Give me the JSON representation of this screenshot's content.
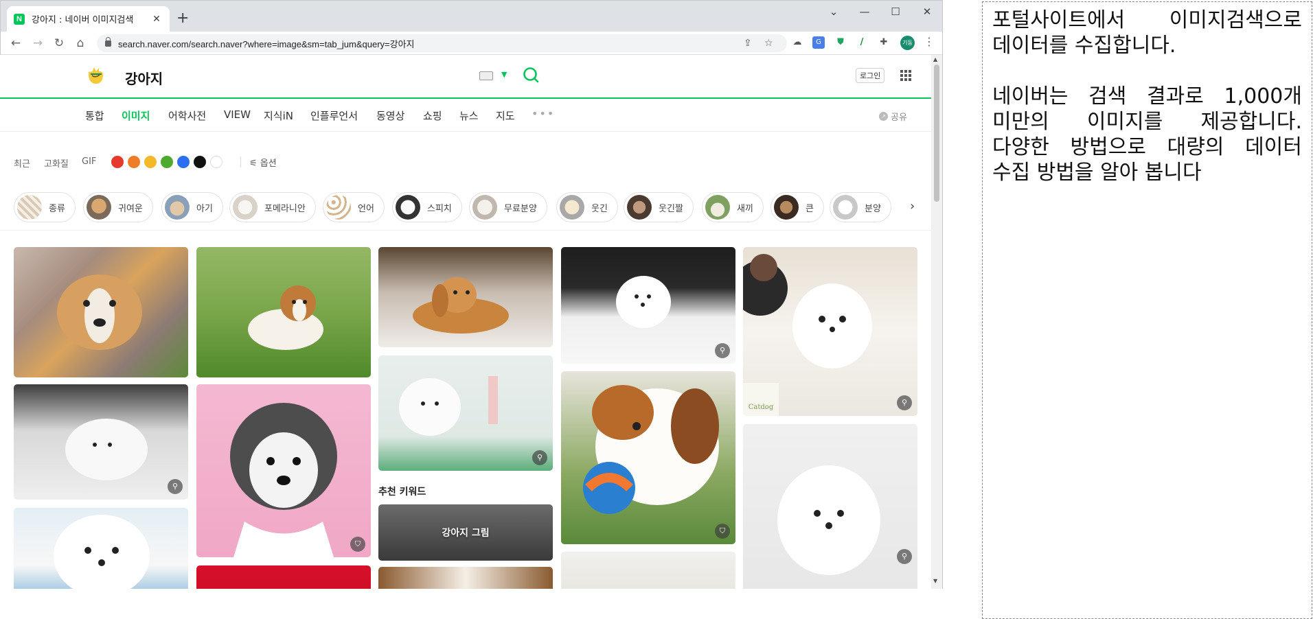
{
  "browser": {
    "tab_title": "강아지 : 네이버 이미지검색",
    "tab_favicon": "N",
    "tab_close_icon": "✕",
    "new_tab_icon": "+",
    "window_controls": {
      "dropdown": "⌄",
      "minimize": "—",
      "maximize": "☐",
      "close": "✕"
    },
    "url": "search.naver.com/search.naver?where=image&sm=tab_jum&query=강아지",
    "profile_label": "기동"
  },
  "naver": {
    "query": "강아지",
    "login_label": "로그인",
    "accent_color": "#03c75a",
    "tabs": [
      {
        "label": "통합",
        "active": false
      },
      {
        "label": "이미지",
        "active": true
      },
      {
        "label": "어학사전",
        "active": false
      },
      {
        "label": "VIEW",
        "active": false
      },
      {
        "label": "지식iN",
        "active": false
      },
      {
        "label": "인플루언서",
        "active": false
      },
      {
        "label": "동영상",
        "active": false
      },
      {
        "label": "쇼핑",
        "active": false
      },
      {
        "label": "뉴스",
        "active": false
      },
      {
        "label": "지도",
        "active": false
      }
    ],
    "more_label": "•••",
    "share_label": "공유",
    "filters": {
      "recent": "최근",
      "hd": "고화질",
      "gif": "GIF",
      "option": "옵션"
    },
    "filter_colors": [
      "#e8372c",
      "#f07c28",
      "#f5b829",
      "#4eaa2f",
      "#2b6ff0",
      "#111111",
      "#ffffff"
    ],
    "chips": [
      {
        "label": "종류"
      },
      {
        "label": "귀여운"
      },
      {
        "label": "아기"
      },
      {
        "label": "포메라니안"
      },
      {
        "label": "언어"
      },
      {
        "label": "스피치"
      },
      {
        "label": "무료분양"
      },
      {
        "label": "웃긴"
      },
      {
        "label": "웃긴짤"
      },
      {
        "label": "새끼"
      },
      {
        "label": "큰"
      },
      {
        "label": "분양"
      }
    ],
    "recommend_title": "추천 키워드",
    "recommend_item": "강아지 그림",
    "watermark": "Catdog"
  },
  "annotation": {
    "p1": "포털사이트에서 이미지검색으로 데이터를 수집합니다.",
    "p2": "네이버는 검색 결과로 1,000개 미만의 이미지를 제공합니다. 다양한 방법으로 대량의 데이터 수집 방법을 알아 봅니다"
  }
}
